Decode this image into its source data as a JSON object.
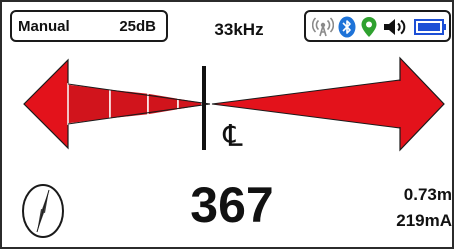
{
  "header": {
    "mode_label": "Manual",
    "gain_label": "25dB",
    "frequency_label": "33kHz"
  },
  "status_icons": [
    {
      "name": "antenna-icon"
    },
    {
      "name": "bluetooth-icon"
    },
    {
      "name": "gps-location-icon"
    },
    {
      "name": "speaker-volume-icon"
    },
    {
      "name": "battery-icon"
    }
  ],
  "guidance": {
    "centerline_symbol": "℄",
    "left_arrow": "left-guidance-arrow",
    "right_arrow": "right-guidance-arrow"
  },
  "readouts": {
    "signal_strength": "367",
    "depth": "0.73m",
    "current": "219mA"
  },
  "colors": {
    "arrow_red": "#e3121b",
    "arrow_dark_red": "#b30b12",
    "bluetooth_blue": "#1e73d8",
    "gps_green": "#2fa12f",
    "battery_blue": "#1d4fd6"
  }
}
